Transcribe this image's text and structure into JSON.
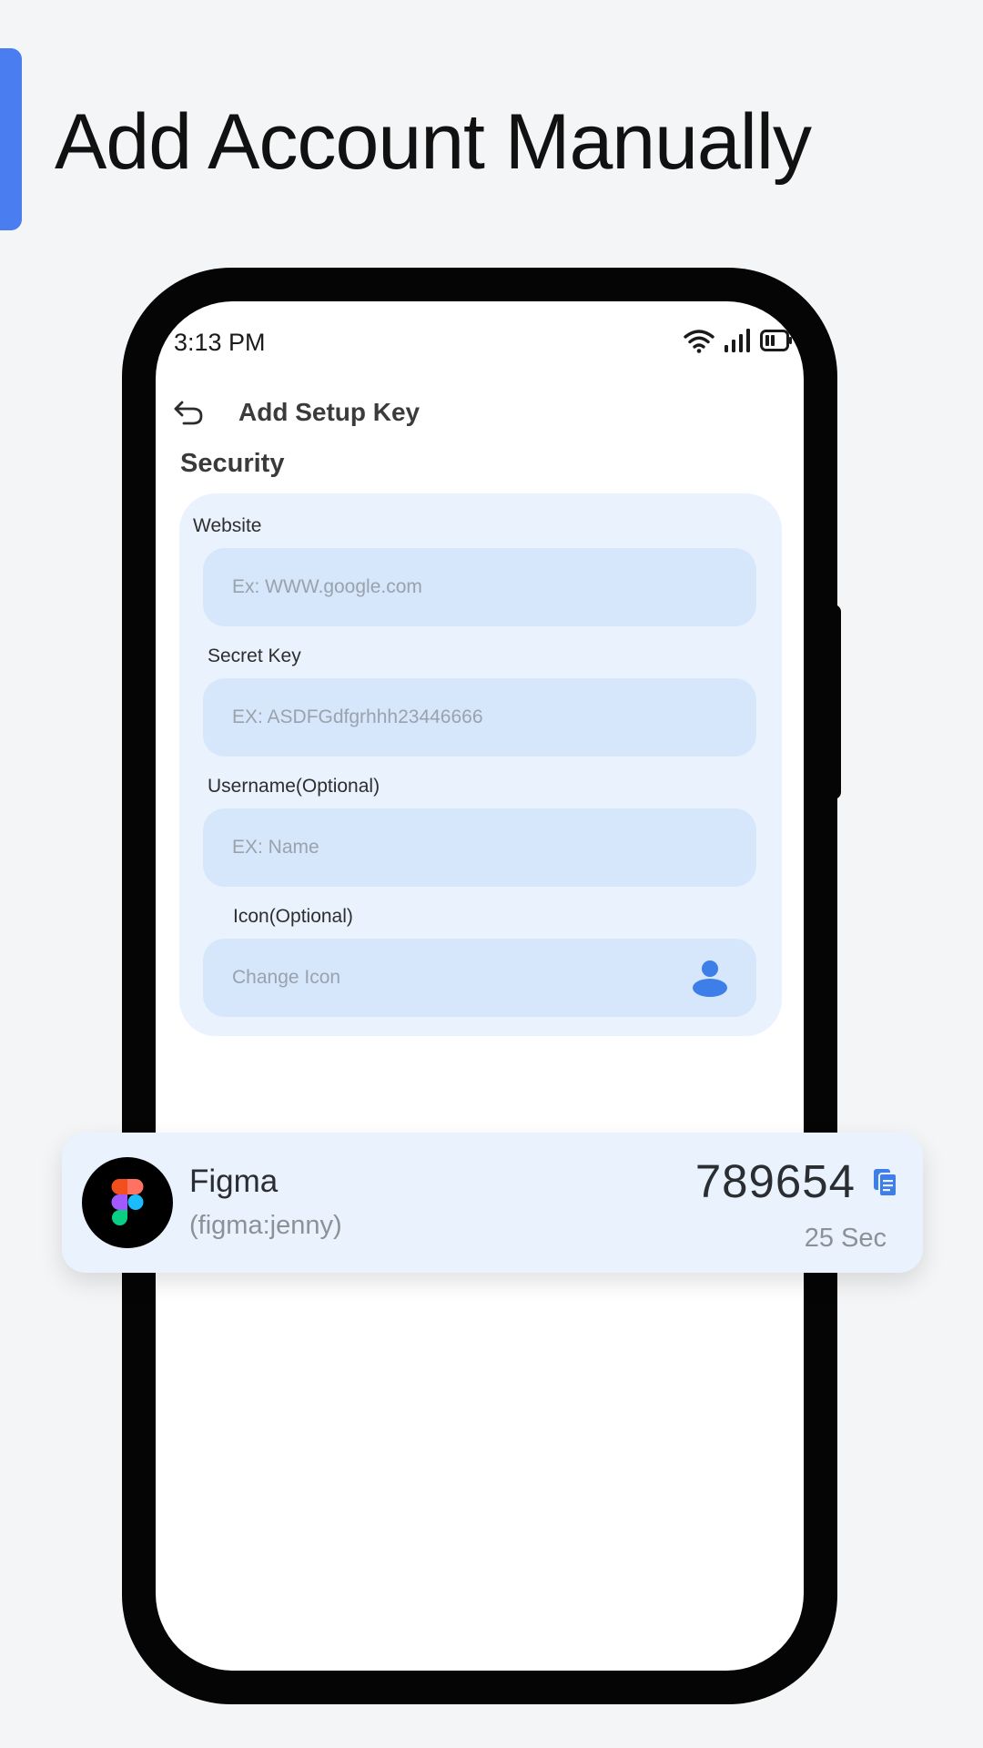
{
  "headline": "Add Account Manually",
  "colors": {
    "accent": "#4a7df0",
    "card_background": "#eaf2fd",
    "input_background": "#d6e6fb",
    "icon_blue": "#3d7ee8"
  },
  "status_bar": {
    "time": "3:13 PM",
    "icons": [
      "wifi-icon",
      "signal-icon",
      "battery-icon"
    ]
  },
  "header": {
    "back_icon": "back-arrow-icon",
    "title": "Add Setup Key"
  },
  "security": {
    "section_title": "Security",
    "fields": {
      "website": {
        "label": "Website",
        "placeholder": "Ex: WWW.google.com",
        "value": ""
      },
      "secret_key": {
        "label": "Secret Key",
        "placeholder": "EX: ASDFGdfgrhhh23446666",
        "value": ""
      },
      "username": {
        "label": "Username(Optional)",
        "placeholder": "EX: Name",
        "value": ""
      },
      "icon": {
        "label": "Icon(Optional)",
        "placeholder": "Change Icon",
        "icon": "user-icon"
      }
    }
  },
  "account_card": {
    "logo_icon": "figma-logo-icon",
    "name": "Figma",
    "username": "(figma:jenny)",
    "code": "789654",
    "copy_icon": "copy-icon",
    "timer": "25 Sec"
  }
}
